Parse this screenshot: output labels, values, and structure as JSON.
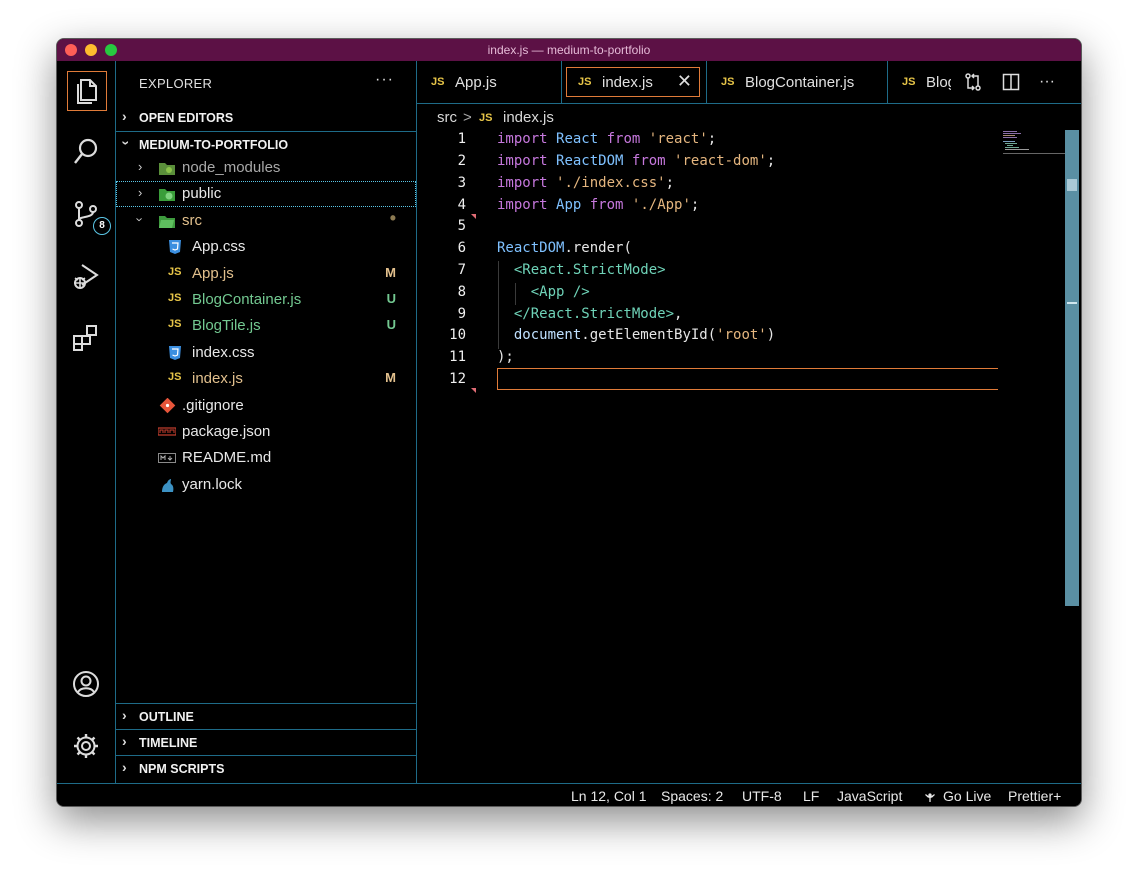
{
  "window": {
    "title": "index.js — medium-to-portfolio"
  },
  "activity": {
    "scm_badge": "8"
  },
  "sidebar": {
    "title": "EXPLORER",
    "more": "···",
    "open_editors": "OPEN EDITORS",
    "project": "MEDIUM-TO-PORTFOLIO",
    "tree": [
      {
        "name": "node_modules",
        "status": ""
      },
      {
        "name": "public",
        "status": ""
      },
      {
        "name": "src",
        "status": "•"
      },
      {
        "name": "App.css",
        "status": ""
      },
      {
        "name": "App.js",
        "status": "M"
      },
      {
        "name": "BlogContainer.js",
        "status": "U"
      },
      {
        "name": "BlogTile.js",
        "status": "U"
      },
      {
        "name": "index.css",
        "status": ""
      },
      {
        "name": "index.js",
        "status": "M"
      },
      {
        "name": ".gitignore",
        "status": ""
      },
      {
        "name": "package.json",
        "status": ""
      },
      {
        "name": "README.md",
        "status": ""
      },
      {
        "name": "yarn.lock",
        "status": ""
      }
    ],
    "outline": "OUTLINE",
    "timeline": "TIMELINE",
    "npm_scripts": "NPM SCRIPTS"
  },
  "tabs": [
    {
      "icon": "JS",
      "label": "App.js"
    },
    {
      "icon": "JS",
      "label": "index.js"
    },
    {
      "icon": "JS",
      "label": "BlogContainer.js"
    },
    {
      "icon": "JS",
      "label": "Blog"
    }
  ],
  "breadcrumb": {
    "folder": "src",
    "sep": ">",
    "icon": "JS",
    "file": "index.js"
  },
  "editor": {
    "line_numbers": [
      "1",
      "2",
      "3",
      "4",
      "5",
      "6",
      "7",
      "8",
      "9",
      "10",
      "11",
      "12"
    ]
  },
  "status": {
    "position": "Ln 12, Col 1",
    "spaces": "Spaces: 2",
    "encoding": "UTF-8",
    "eol": "LF",
    "language": "JavaScript",
    "live": "Go Live",
    "prettier": "Prettier+"
  },
  "colors": {
    "titlebar": "#5c1145",
    "accent_border": "#e07b39",
    "panel_border": "#1e6b88",
    "modified": "#e2c08d",
    "untracked": "#73c991"
  }
}
